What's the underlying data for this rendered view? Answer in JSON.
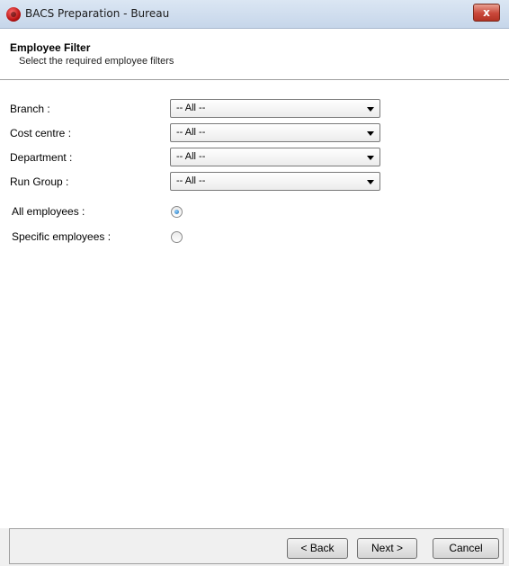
{
  "window": {
    "title": "BACS Preparation - Bureau",
    "close_label": "x",
    "icon": "app-logo-icon"
  },
  "header": {
    "title": "Employee Filter",
    "subtitle": "Select the required employee filters"
  },
  "filters": [
    {
      "label": "Branch :",
      "selected": "-- All --"
    },
    {
      "label": "Cost centre :",
      "selected": "-- All --"
    },
    {
      "label": "Department :",
      "selected": "-- All --"
    },
    {
      "label": "Run Group :",
      "selected": "-- All --"
    }
  ],
  "employees": {
    "all_label": "All employees :",
    "specific_label": "Specific employees :",
    "selected": "all"
  },
  "buttons": {
    "back": "< Back",
    "next": "Next >",
    "cancel": "Cancel"
  },
  "colors": {
    "title_bar": "#c6d6ea",
    "close_button": "#c9473a",
    "radio_checked": "#1f6fb5"
  }
}
